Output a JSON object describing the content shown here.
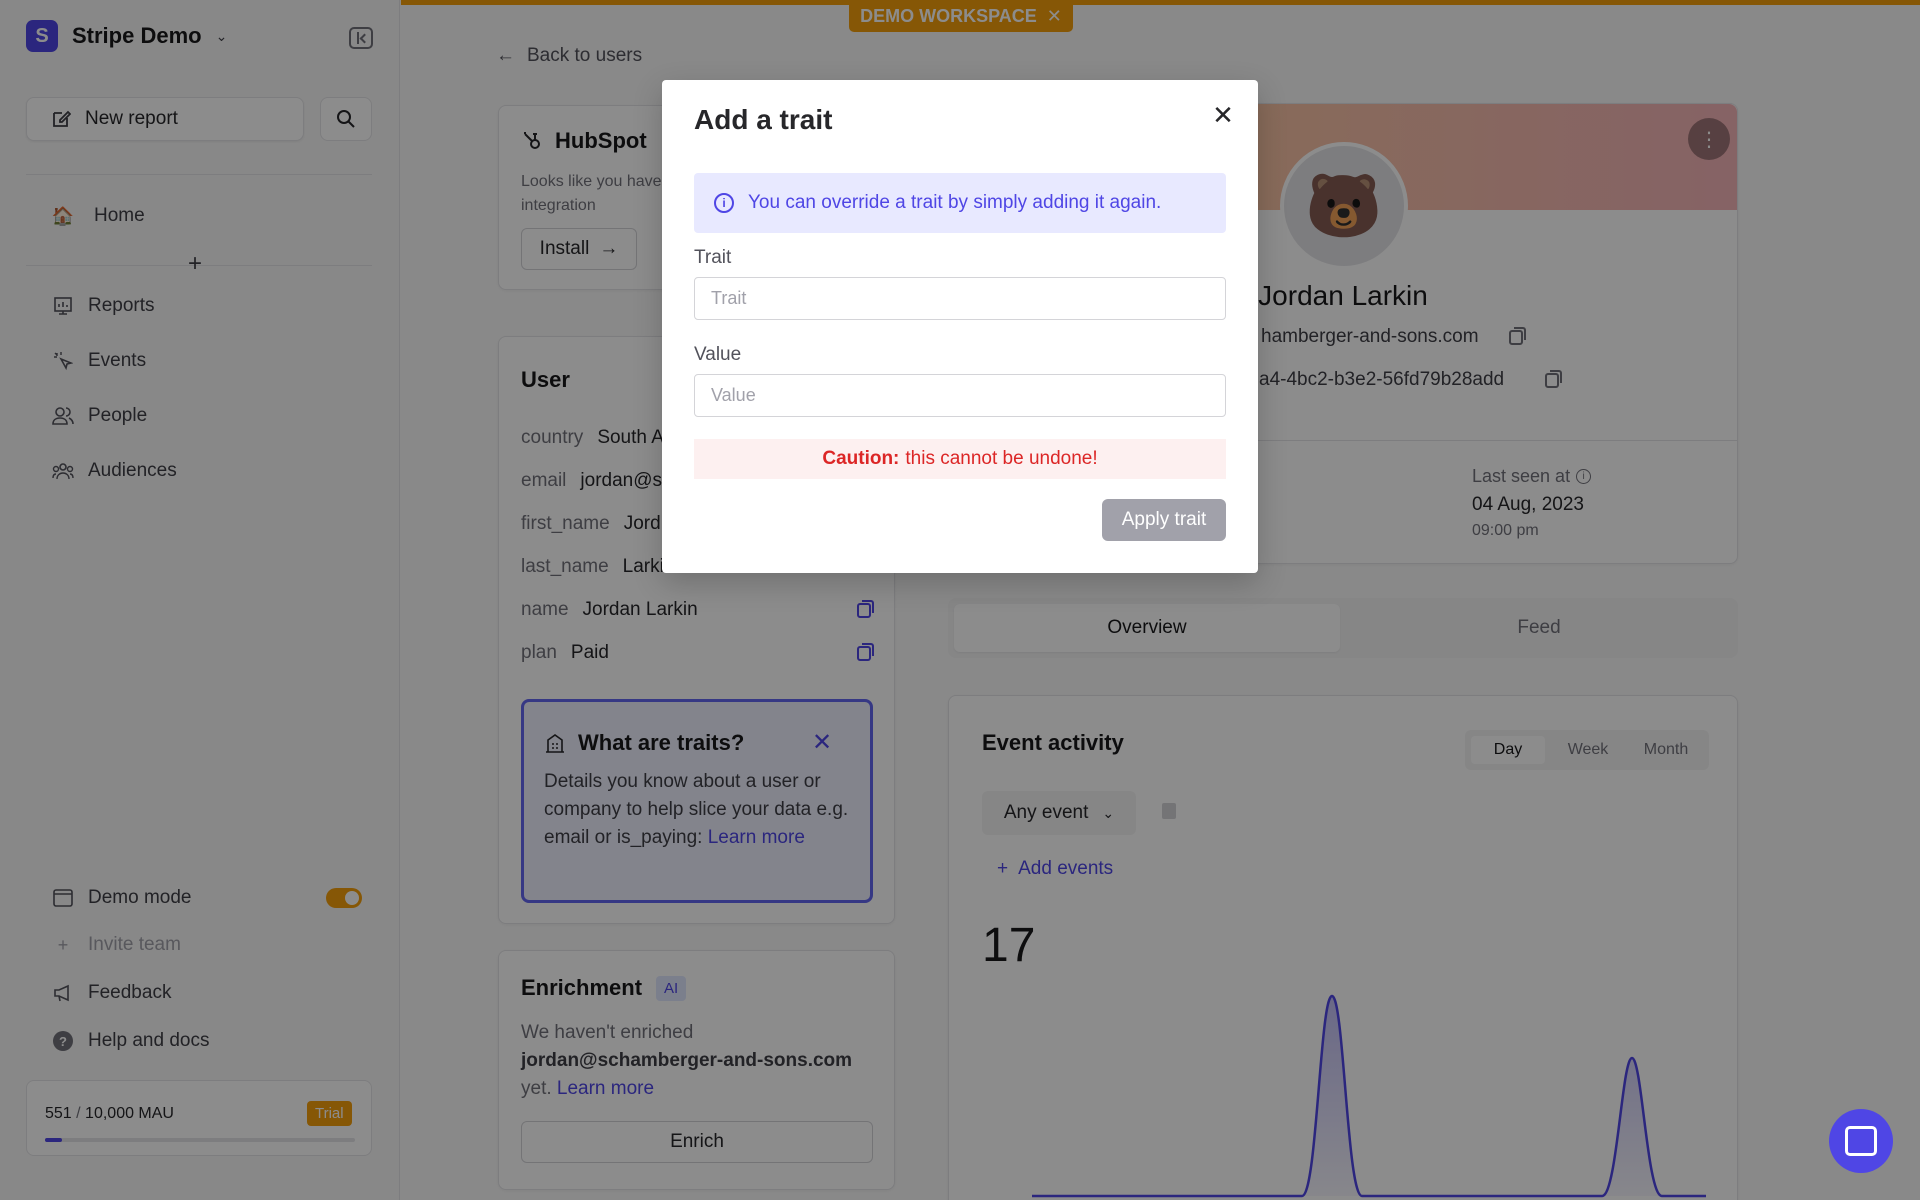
{
  "workspace": {
    "logo_letter": "S",
    "name": "Stripe Demo"
  },
  "sidebar": {
    "new_report": "New report",
    "home": "Home",
    "items": [
      {
        "label": "Reports"
      },
      {
        "label": "Events"
      },
      {
        "label": "People"
      },
      {
        "label": "Audiences"
      }
    ],
    "demo_mode": "Demo mode",
    "invite_team": "Invite team",
    "feedback": "Feedback",
    "help": "Help and docs",
    "mau_used": "551",
    "mau_total": "10,000 MAU",
    "mau_fraction": 0.0551,
    "trial": "Trial"
  },
  "banner": {
    "label": "DEMO WORKSPACE"
  },
  "back_link": "Back to users",
  "hubspot": {
    "title": "HubSpot",
    "desc_line1": "Looks like you have",
    "desc_line2": "integration",
    "install": "Install"
  },
  "user_card": {
    "title": "User",
    "traits": [
      {
        "key": "country",
        "value": "South A"
      },
      {
        "key": "email",
        "value": "jordan@sc"
      },
      {
        "key": "first_name",
        "value": "Jord"
      },
      {
        "key": "last_name",
        "value": "Larki"
      },
      {
        "key": "name",
        "value": "Jordan Larkin"
      },
      {
        "key": "plan",
        "value": "Paid"
      }
    ],
    "what_title": "What are traits?",
    "what_body": "Details you know about a user or company to help slice your data e.g. email or is_paying:",
    "what_link_1": "Learn",
    "what_link_2": "more"
  },
  "enrichment": {
    "title": "Enrichment",
    "badge": "AI",
    "line1": "We haven't enriched",
    "email": "jordan@schamberger-and-sons.com",
    "line3": "yet.",
    "link": "Learn more",
    "button": "Enrich"
  },
  "profile": {
    "avatar": "🐻",
    "name": "Jordan Larkin",
    "domain": "hamberger-and-sons.com",
    "id": "a4-4bc2-b3e2-56fd79b28add",
    "last_seen_label": "Last seen at",
    "last_seen_date": "04 Aug, 2023",
    "last_seen_time": "09:00 pm"
  },
  "tabs": {
    "overview": "Overview",
    "feed": "Feed"
  },
  "activity": {
    "title": "Event activity",
    "ranges": [
      "Day",
      "Week",
      "Month"
    ],
    "event_select": "Any event",
    "add_events": "Add events",
    "total": "17"
  },
  "modal": {
    "title": "Add a trait",
    "info": "You can override a trait by simply adding it again.",
    "trait_label": "Trait",
    "trait_placeholder": "Trait",
    "value_label": "Value",
    "value_placeholder": "Value",
    "caution_strong": "Caution:",
    "caution_text": "this cannot be undone!",
    "apply": "Apply trait"
  },
  "colors": {
    "accent": "#4f46e5",
    "warning": "#f59e0b",
    "danger": "#dc2626"
  }
}
